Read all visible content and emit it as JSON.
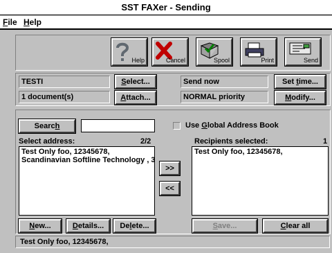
{
  "window": {
    "title": "SST FAXer - Sending"
  },
  "menu": [
    {
      "label": "File",
      "ul": "F",
      "rest": "ile"
    },
    {
      "label": "Help",
      "ul": "H",
      "rest": "elp"
    }
  ],
  "toolbar": {
    "help": "Help",
    "cancel": "Cancel",
    "spool": "Spool",
    "print": "Print",
    "send": "Send"
  },
  "info": {
    "name": "TESTI",
    "documents": "1 document(s)",
    "send_time": "Send now",
    "priority": "NORMAL priority",
    "select_btn": {
      "pre": "",
      "ul": "S",
      "post": "elect..."
    },
    "attach_btn": {
      "pre": "",
      "ul": "A",
      "post": "ttach..."
    },
    "settime_btn": {
      "pre": "Set ",
      "ul": "t",
      "post": "ime..."
    },
    "modify_btn": {
      "pre": "",
      "ul": "M",
      "post": "odify..."
    }
  },
  "search": {
    "button": {
      "pre": "Searc",
      "ul": "h",
      "post": ""
    },
    "value": ""
  },
  "global_address": {
    "pre": "Use ",
    "ul": "G",
    "post": "lobal Address Book",
    "checked": false
  },
  "select_address": {
    "label": "Select address:",
    "count": "2/2",
    "items": [
      "Test Only foo, 12345678,",
      "Scandinavian Softline Technology , 3"
    ]
  },
  "recipients": {
    "label": "Recipients selected:",
    "count": "1",
    "items": [
      "Test Only foo, 12345678,"
    ]
  },
  "move": {
    "add": ">>",
    "remove": "<<"
  },
  "bottom_buttons": {
    "new": {
      "pre": "",
      "ul": "N",
      "post": "ew..."
    },
    "details": {
      "pre": "",
      "ul": "D",
      "post": "etails..."
    },
    "delete": {
      "pre": "De",
      "ul": "l",
      "post": "ete..."
    },
    "save": {
      "pre": "",
      "ul": "S",
      "post": "ave..."
    },
    "clear": {
      "pre": "",
      "ul": "C",
      "post": "lear all"
    }
  },
  "status": "Test Only foo, 12345678,"
}
